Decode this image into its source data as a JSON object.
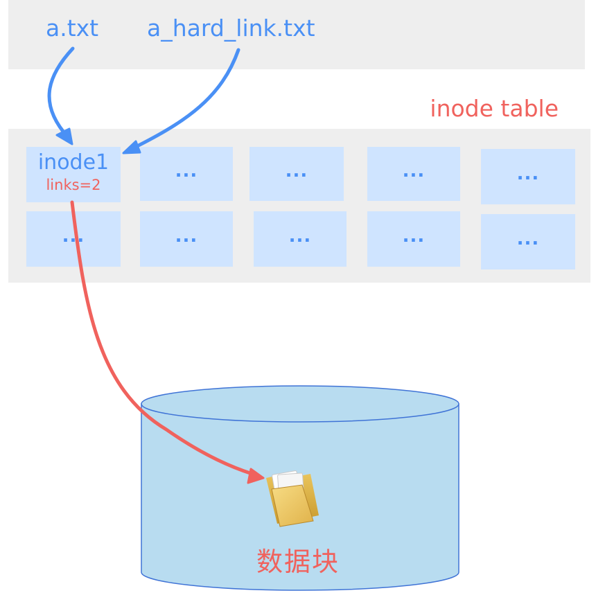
{
  "files": {
    "a_txt": "a.txt",
    "a_hard_link": "a_hard_link.txt"
  },
  "inode_table": {
    "title": "inode table",
    "inode1": {
      "name": "inode1",
      "links": "links=2"
    },
    "placeholder": "..."
  },
  "data_block": {
    "label": "数据块",
    "icon": "folder-icon"
  },
  "colors": {
    "file_arrow": "#4a90f5",
    "data_arrow": "#f0625d",
    "cell": "#cfe4ff",
    "cylinder": "#b8dcf0",
    "band": "#eeeeee"
  }
}
